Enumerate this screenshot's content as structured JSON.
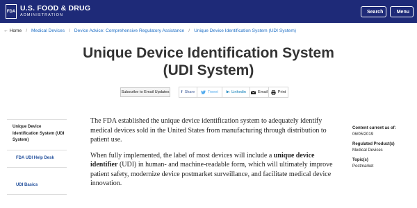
{
  "header": {
    "logo_mark": "FDA",
    "logo_line1": "U.S. FOOD & DRUG",
    "logo_line2": "ADMINISTRATION",
    "search_label": "Search",
    "menu_label": "Menu",
    "bg_color": "#1e2a78"
  },
  "breadcrumb": {
    "home": "Home",
    "items": [
      "Medical Devices",
      "Device Advice: Comprehensive Regulatory Assistance",
      "Unique Device Identification System (UDI System)"
    ]
  },
  "page": {
    "title": "Unique Device Identification System (UDI System)"
  },
  "share": {
    "subscribe": "Subscribe to Email Updates",
    "facebook": "Share",
    "twitter": "Tweet",
    "linkedin": "Linkedin",
    "email": "Email",
    "print": "Print"
  },
  "sidebar": {
    "current": "Unique Device Identification System (UDI System)",
    "links": [
      "FDA UDI Help Desk",
      "UDI Basics"
    ]
  },
  "main": {
    "p1": "The FDA established the unique device identification system to adequately identify medical devices sold in the United States from manufacturing through distribution to patient use.",
    "p2_before": "When fully implemented, the label of most devices will include a ",
    "p2_bold": "unique device identifier",
    "p2_after": " (UDI) in human- and machine-readable form, which will ultimately improve patient safety, modernize device postmarket surveillance, and facilitate medical device innovation."
  },
  "meta": {
    "content_current_label": "Content current as of:",
    "content_current_value": "06/05/2019",
    "regulated_label": "Regulated Product(s)",
    "regulated_value": "Medical Devices",
    "topic_label": "Topic(s)",
    "topic_value": "Postmarket"
  }
}
